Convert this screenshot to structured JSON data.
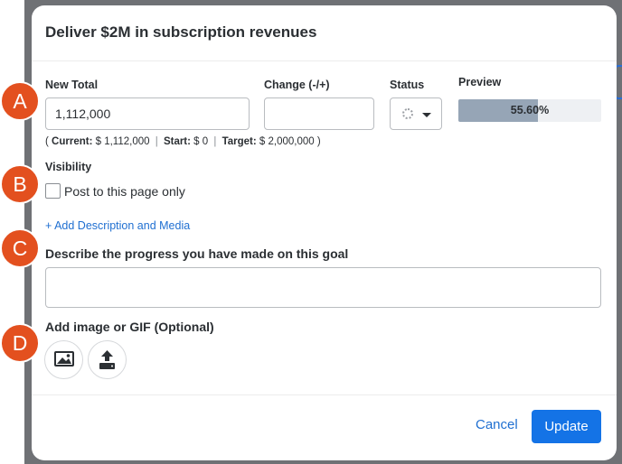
{
  "modal": {
    "title": "Deliver $2M in subscription revenues"
  },
  "fields": {
    "new_total_label": "New Total",
    "new_total_value": "1,112,000",
    "change_label": "Change (-/+)",
    "change_value": "",
    "status_label": "Status",
    "preview_label": "Preview"
  },
  "progress": {
    "percent": 55.6,
    "text": "55.60%"
  },
  "summary": {
    "open_paren": "(",
    "current_label": "Current:",
    "current_value": "$ 1,112,000",
    "sep": "|",
    "start_label": "Start:",
    "start_value": "$ 0",
    "target_label": "Target:",
    "target_value": "$ 2,000,000",
    "close_paren": ")"
  },
  "visibility": {
    "label": "Visibility",
    "checkbox_label": "Post to this page only"
  },
  "add_description_link": "+ Add Description and Media",
  "progress_description": {
    "label": "Describe the progress you have made on this goal",
    "value": ""
  },
  "media": {
    "label": "Add image or GIF (Optional)",
    "buttons": [
      "image-icon",
      "upload-icon"
    ]
  },
  "footer": {
    "cancel_label": "Cancel",
    "update_label": "Update"
  },
  "annotations": [
    "A",
    "B",
    "C",
    "D"
  ],
  "colors": {
    "accent": "#1473e6",
    "link": "#1f6fd1",
    "badge": "#e3501f",
    "progress_fill": "#96a5b6"
  }
}
